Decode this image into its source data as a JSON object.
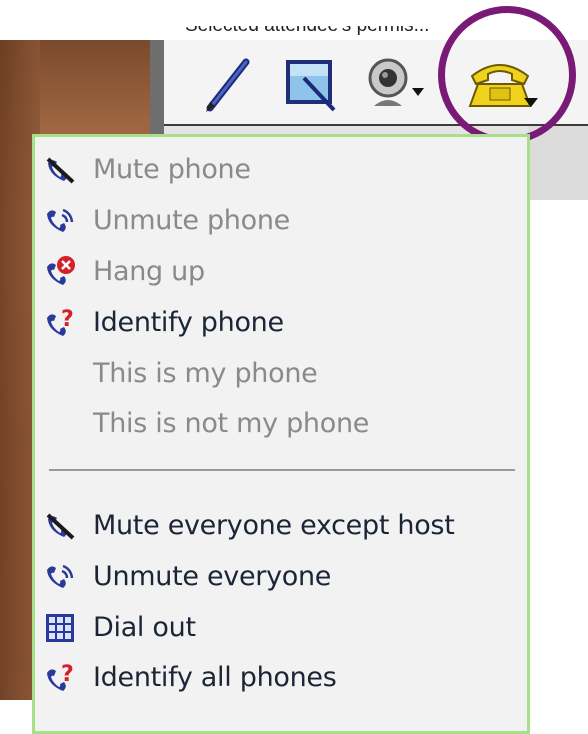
{
  "header": {
    "cut_text": "Selected attendee's permis..."
  },
  "toolbar": {
    "tools": [
      {
        "icon": "pencil-icon"
      },
      {
        "icon": "whiteboard-icon"
      },
      {
        "icon": "webcam-icon"
      },
      {
        "icon": "telephone-icon",
        "color": "#f0d21c"
      }
    ],
    "highlight_color": "#7a1a77"
  },
  "menu": {
    "border_color": "#a8e08a",
    "items": [
      {
        "label": "Mute phone",
        "icon": "mute-phone-icon",
        "enabled": false
      },
      {
        "label": "Unmute phone",
        "icon": "unmute-phone-icon",
        "enabled": false
      },
      {
        "label": "Hang up",
        "icon": "hang-up-icon",
        "enabled": false
      },
      {
        "label": "Identify phone",
        "icon": "identify-phone-icon",
        "enabled": true
      },
      {
        "label": "This is my phone",
        "icon": "",
        "enabled": false
      },
      {
        "label": "This is not my phone",
        "icon": "",
        "enabled": false
      },
      {
        "label": "Mute everyone except host",
        "icon": "mute-all-icon",
        "enabled": true
      },
      {
        "label": "Unmute everyone",
        "icon": "unmute-all-icon",
        "enabled": true
      },
      {
        "label": "Dial out",
        "icon": "dial-out-icon",
        "enabled": true
      },
      {
        "label": "Identify all phones",
        "icon": "identify-all-icon",
        "enabled": true
      }
    ]
  }
}
